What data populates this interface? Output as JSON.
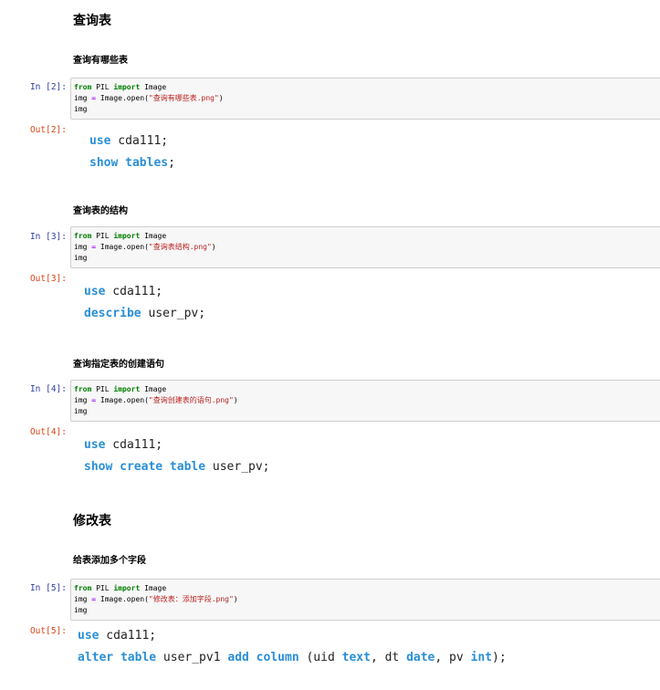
{
  "sections": [
    {
      "heading": "查询表",
      "subheading": "查询有哪些表",
      "in_prompt": "In [2]:",
      "out_prompt": "Out[2]:",
      "code": {
        "l1_kw1": "from",
        "l1_mod": " PIL ",
        "l1_kw2": "import",
        "l1_name": " Image",
        "l2_var": "img ",
        "l2_op": "=",
        "l2_call": " Image.open(",
        "l2_str": "\"查询有哪些表.png\"",
        "l2_end": ")",
        "l3": "img"
      },
      "sql": [
        {
          "kw": "use",
          "rest": " cda111;"
        },
        {
          "kw": "show tables",
          "rest": ";"
        }
      ]
    },
    {
      "subheading": "查询表的结构",
      "in_prompt": "In [3]:",
      "out_prompt": "Out[3]:",
      "code": {
        "l1_kw1": "from",
        "l1_mod": " PIL ",
        "l1_kw2": "import",
        "l1_name": " Image",
        "l2_var": "img ",
        "l2_op": "=",
        "l2_call": " Image.open(",
        "l2_str": "\"查询表结构.png\"",
        "l2_end": ")",
        "l3": "img"
      },
      "sql": [
        {
          "kw": "use",
          "rest": " cda111;"
        },
        {
          "kw": "describe",
          "rest": " user_pv;"
        }
      ]
    },
    {
      "subheading": "查询指定表的创建语句",
      "in_prompt": "In [4]:",
      "out_prompt": "Out[4]:",
      "code": {
        "l1_kw1": "from",
        "l1_mod": " PIL ",
        "l1_kw2": "import",
        "l1_name": " Image",
        "l2_var": "img ",
        "l2_op": "=",
        "l2_call": " Image.open(",
        "l2_str": "\"查询创建表的语句.png\"",
        "l2_end": ")",
        "l3": "img"
      },
      "sql": [
        {
          "kw": "use",
          "rest": " cda111;"
        },
        {
          "kw": "show create table",
          "rest": " user_pv;"
        }
      ]
    },
    {
      "heading": "修改表",
      "subheading": "给表添加多个字段",
      "in_prompt": "In [5]:",
      "out_prompt": "Out[5]:",
      "code": {
        "l1_kw1": "from",
        "l1_mod": " PIL ",
        "l1_kw2": "import",
        "l1_name": " Image",
        "l2_var": "img ",
        "l2_op": "=",
        "l2_call": " Image.open(",
        "l2_str": "\"修改表：添加字段.png\"",
        "l2_end": ")",
        "l3": "img"
      },
      "sql_l1": {
        "kw": "use",
        "rest": " cda111;"
      },
      "sql_l2": {
        "kw1": "alter table",
        "t1": " user_pv1 ",
        "kw2": "add column",
        "t2": " (uid ",
        "kw3": "text",
        "t3": ", dt ",
        "kw4": "date",
        "t4": ", pv ",
        "kw5": "int",
        "t5": ");"
      }
    }
  ],
  "colors": {
    "in_prompt": "#303f9f",
    "out_prompt": "#d84315",
    "sql_keyword": "#2a8fd6"
  }
}
